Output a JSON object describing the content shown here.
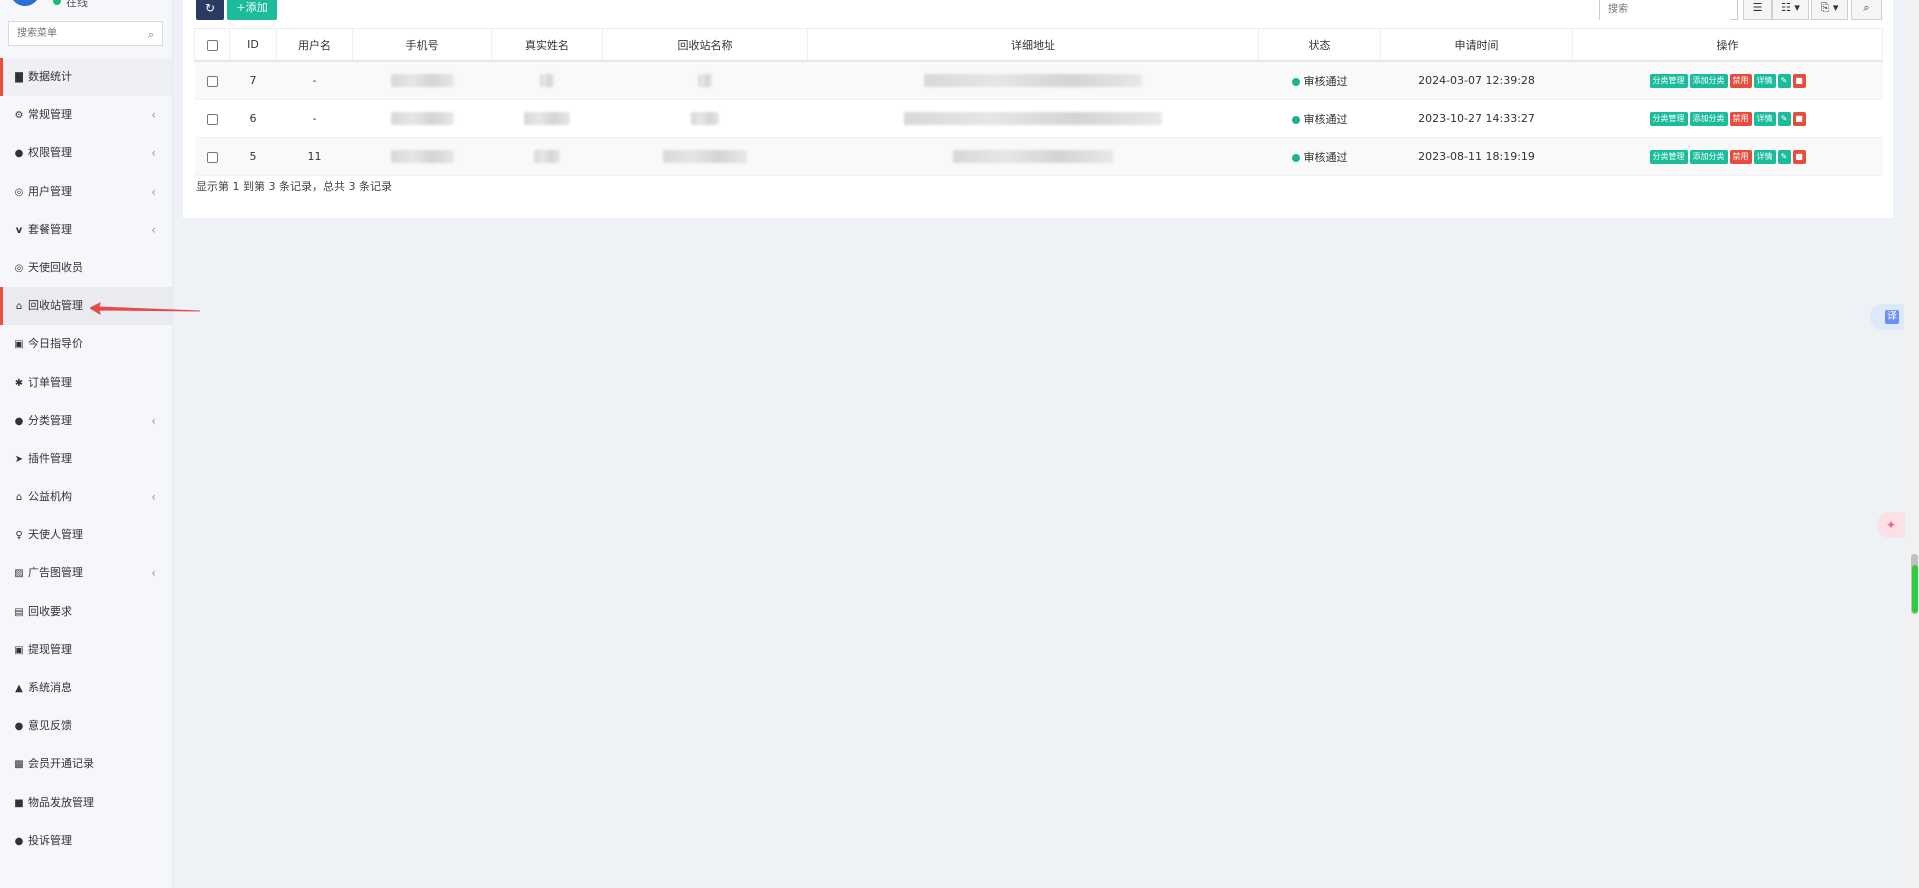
{
  "sidebar": {
    "user_status": "在线",
    "search_placeholder": "搜索菜单",
    "items": [
      {
        "label": "数据统计",
        "icon": "bar-chart-icon",
        "has_arrow": false
      },
      {
        "label": "常规管理",
        "icon": "cogs-icon",
        "has_arrow": true
      },
      {
        "label": "权限管理",
        "icon": "users-icon",
        "has_arrow": true
      },
      {
        "label": "用户管理",
        "icon": "user-circle-icon",
        "has_arrow": true
      },
      {
        "label": "套餐管理",
        "icon": "vimeo-icon",
        "has_arrow": true
      },
      {
        "label": "天使回收员",
        "icon": "user-circle-icon",
        "has_arrow": false
      },
      {
        "label": "回收站管理",
        "icon": "bank-icon",
        "has_arrow": false
      },
      {
        "label": "今日指导价",
        "icon": "money-icon",
        "has_arrow": false
      },
      {
        "label": "订单管理",
        "icon": "asterisk-icon",
        "has_arrow": false
      },
      {
        "label": "分类管理",
        "icon": "circle-icon",
        "has_arrow": true
      },
      {
        "label": "插件管理",
        "icon": "rocket-icon",
        "has_arrow": false
      },
      {
        "label": "公益机构",
        "icon": "bank-icon",
        "has_arrow": true
      },
      {
        "label": "天使人管理",
        "icon": "user-icon",
        "has_arrow": false
      },
      {
        "label": "广告图管理",
        "icon": "image-icon",
        "has_arrow": true
      },
      {
        "label": "回收要求",
        "icon": "file-icon",
        "has_arrow": false
      },
      {
        "label": "提现管理",
        "icon": "money-icon",
        "has_arrow": false
      },
      {
        "label": "系统消息",
        "icon": "bell-icon",
        "has_arrow": false
      },
      {
        "label": "意见反馈",
        "icon": "comments-icon",
        "has_arrow": false
      },
      {
        "label": "会员开通记录",
        "icon": "vimeo-square-icon",
        "has_arrow": false
      },
      {
        "label": "物品发放管理",
        "icon": "archive-icon",
        "has_arrow": false
      },
      {
        "label": "投诉管理",
        "icon": "comment-icon",
        "has_arrow": false
      }
    ]
  },
  "toolbar": {
    "add_label": "添加",
    "search_placeholder": "搜索"
  },
  "table": {
    "columns": [
      "ID",
      "用户名",
      "手机号",
      "真实姓名",
      "回收站名称",
      "详细地址",
      "状态",
      "申请时间",
      "操作"
    ],
    "rows": [
      {
        "id": "7",
        "username": "-",
        "status": "审核通过",
        "time": "2024-03-07 12:39:28"
      },
      {
        "id": "6",
        "username": "-",
        "status": "审核通过",
        "time": "2023-10-27 14:33:27"
      },
      {
        "id": "5",
        "username": "11",
        "status": "审核通过",
        "time": "2023-08-11 18:19:19"
      }
    ],
    "op_labels": {
      "category": "分类管理",
      "add_category": "添加分类",
      "disable": "禁用",
      "detail": "详情"
    }
  },
  "footer": {
    "summary": "显示第 1 到第 3 条记录，总共 3 条记录"
  },
  "floaters": {
    "translate_label": "译"
  },
  "colors": {
    "accent_green": "#1abc9c",
    "danger_red": "#e74c3c",
    "navy": "#2b3a62",
    "active_marker": "#e8503a"
  }
}
